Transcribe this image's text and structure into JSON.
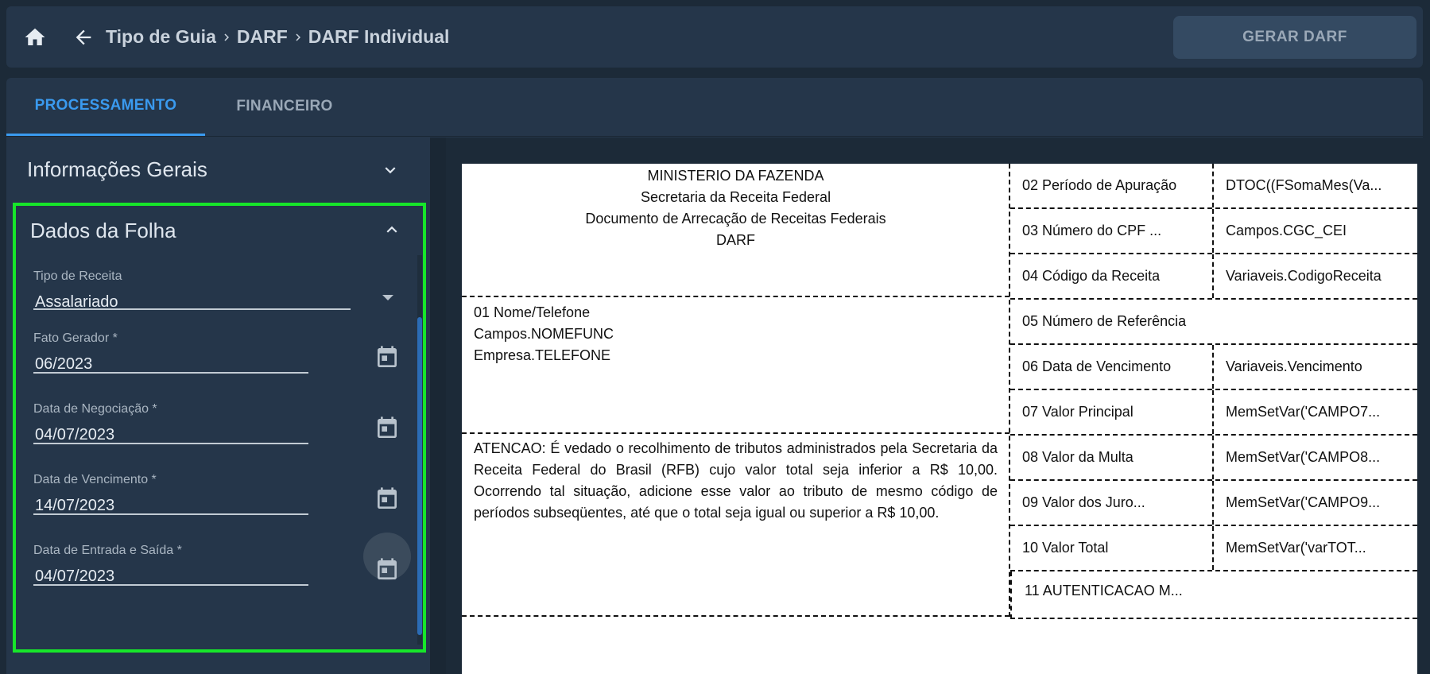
{
  "breadcrumb": [
    "Tipo de Guia",
    "DARF",
    "DARF Individual"
  ],
  "header": {
    "generate_label": "GERAR DARF"
  },
  "tabs": [
    {
      "label": "PROCESSAMENTO",
      "active": true
    },
    {
      "label": "FINANCEIRO",
      "active": false
    }
  ],
  "sections": {
    "info": "Informações Gerais",
    "folha": "Dados da Folha"
  },
  "fields": {
    "tipo_receita": {
      "label": "Tipo de Receita",
      "value": "Assalariado"
    },
    "fato_gerador": {
      "label": "Fato Gerador *",
      "value": "06/2023"
    },
    "data_negociacao": {
      "label": "Data de Negociação *",
      "value": "04/07/2023"
    },
    "data_vencimento": {
      "label": "Data de Vencimento *",
      "value": "14/07/2023"
    },
    "data_entrada_saida": {
      "label": "Data de Entrada e Saída *",
      "value": "04/07/2023"
    }
  },
  "darf": {
    "header_lines": [
      "MINISTERIO DA FAZENDA",
      "Secretaria da Receita Federal",
      "Documento de Arrecação de Receitas Federais",
      "DARF"
    ],
    "name_lines": [
      "01 Nome/Telefone",
      "Campos.NOMEFUNC",
      "Empresa.TELEFONE"
    ],
    "attention": "ATENCAO: É vedado o recolhimento de tributos administrados pela Secretaria da Receita Federal do Brasil (RFB) cujo valor total seja inferior a R$ 10,00. Ocorrendo tal situação, adicione esse valor ao tributo de mesmo código de períodos subseqüentes, até que o total seja igual ou superior a R$ 10,00.",
    "rows": [
      {
        "label": "02 Período de Apuração",
        "value": "DTOC((FSomaMes(Va..."
      },
      {
        "label": "03 Número do CPF ...",
        "value": "Campos.CGC_CEI"
      },
      {
        "label": "04 Código da Receita",
        "value": "Variaveis.CodigoReceita"
      },
      {
        "label": "05 Número de Referência",
        "value": ""
      },
      {
        "label": "06 Data de Vencimento",
        "value": "Variaveis.Vencimento"
      },
      {
        "label": "07 Valor Principal",
        "value": "MemSetVar('CAMPO7..."
      },
      {
        "label": "08 Valor da Multa",
        "value": "MemSetVar('CAMPO8..."
      },
      {
        "label": "09 Valor dos Juro...",
        "value": "MemSetVar('CAMPO9..."
      },
      {
        "label": "10 Valor Total",
        "value": "MemSetVar('varTOT..."
      }
    ],
    "last_row": "11 AUTENTICACAO M..."
  },
  "colors": {
    "accent": "#3a9aef",
    "highlight": "#17e62a"
  }
}
